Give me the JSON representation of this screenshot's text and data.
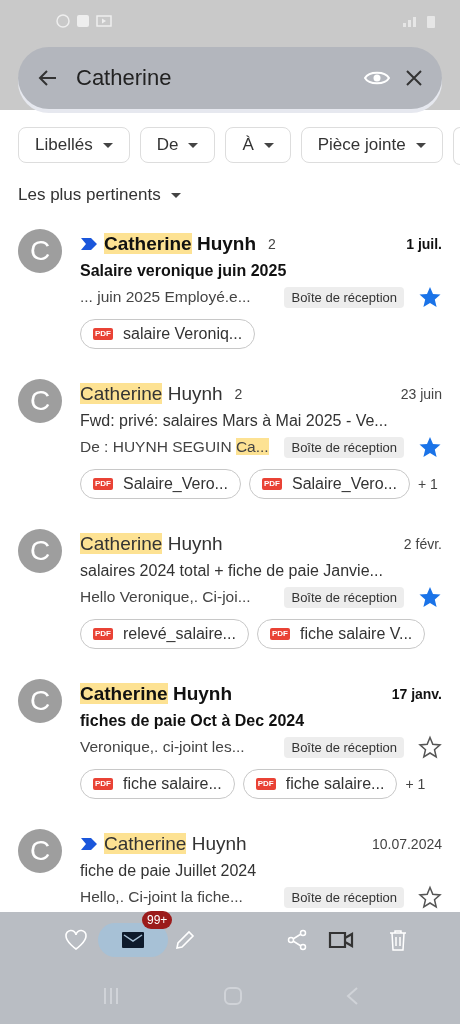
{
  "search": {
    "value": "Catherine"
  },
  "filters": [
    {
      "label": "Libellés"
    },
    {
      "label": "De"
    },
    {
      "label": "À"
    },
    {
      "label": "Pièce jointe"
    }
  ],
  "sort": {
    "label": "Les plus pertinents"
  },
  "emails": [
    {
      "avatar": "C",
      "important": true,
      "unread": true,
      "sender": [
        {
          "text": "Catherine",
          "highlight": true
        },
        {
          "text": " Huynh",
          "highlight": false
        }
      ],
      "count": "2",
      "date": "1 juil.",
      "subject": "Salaire veronique juin 2025",
      "snippet": [
        {
          "text": "... juin 2025 Employé.e...",
          "highlight": false
        }
      ],
      "label": "Boîte de réception",
      "starred": true,
      "attachments": [
        {
          "type": "PDF",
          "name": "salaire Veroniq..."
        }
      ]
    },
    {
      "avatar": "C",
      "important": false,
      "unread": false,
      "sender": [
        {
          "text": "Catherine",
          "highlight": true
        },
        {
          "text": " Huynh",
          "highlight": false
        }
      ],
      "count": "2",
      "date": "23 juin",
      "subject": "Fwd: privé: salaires Mars à Mai 2025 - Ve...",
      "snippet": [
        {
          "text": "De : HUYNH SEGUIN ",
          "highlight": false
        },
        {
          "text": "Ca...",
          "highlight": true
        }
      ],
      "label": "Boîte de réception",
      "starred": true,
      "attachments": [
        {
          "type": "PDF",
          "name": "Salaire_Vero..."
        },
        {
          "type": "PDF",
          "name": "Salaire_Vero..."
        }
      ],
      "more": "+ 1"
    },
    {
      "avatar": "C",
      "important": false,
      "unread": false,
      "sender": [
        {
          "text": "Catherine",
          "highlight": true
        },
        {
          "text": " Huynh",
          "highlight": false
        }
      ],
      "date": "2 févr.",
      "subject": "salaires 2024 total + fiche de paie Janvie...",
      "snippet": [
        {
          "text": "Hello Veronique,. Ci-joi...",
          "highlight": false
        }
      ],
      "label": "Boîte de réception",
      "starred": true,
      "attachments": [
        {
          "type": "PDF",
          "name": "relevé_salaire..."
        },
        {
          "type": "PDF",
          "name": "fiche salaire V..."
        }
      ]
    },
    {
      "avatar": "C",
      "important": false,
      "unread": true,
      "sender": [
        {
          "text": "Catherine",
          "highlight": true
        },
        {
          "text": " Huynh",
          "highlight": false
        }
      ],
      "date": "17 janv.",
      "subject": "fiches de paie Oct à Dec 2024",
      "snippet": [
        {
          "text": "Veronique,. ci-joint les...",
          "highlight": false
        }
      ],
      "label": "Boîte de réception",
      "starred": false,
      "attachments": [
        {
          "type": "PDF",
          "name": "fiche salaire..."
        },
        {
          "type": "PDF",
          "name": "fiche salaire..."
        }
      ],
      "more": "+ 1"
    },
    {
      "avatar": "C",
      "important": true,
      "unread": false,
      "sender": [
        {
          "text": "Catherine",
          "highlight": true
        },
        {
          "text": " Huynh",
          "highlight": false
        }
      ],
      "date": "10.07.2024",
      "subject": "fiche de paie Juillet 2024",
      "snippet": [
        {
          "text": "Hello,. Ci-joint la fiche...",
          "highlight": false
        }
      ],
      "label": "Boîte de réception",
      "starred": false
    }
  ],
  "bottom_bar": {
    "badge": "99+"
  }
}
